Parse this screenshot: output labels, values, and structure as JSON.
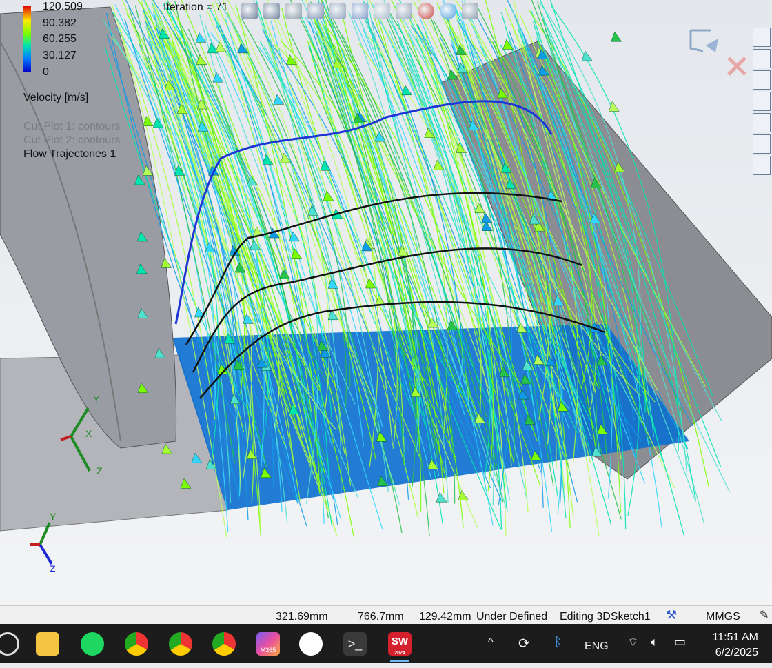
{
  "legend": {
    "ticks": [
      "120.509",
      "90.382",
      "60.255",
      "30.127",
      "0"
    ],
    "title": "Velocity [m/s]",
    "colors": [
      "#e10000",
      "#ffe600",
      "#7cff00",
      "#00e5b0",
      "#0077ff",
      "#0000c8"
    ]
  },
  "plots": [
    {
      "label": "Cut Plot 1: contours",
      "active": false
    },
    {
      "label": "Cut Plot 2: contours",
      "active": false
    },
    {
      "label": "Flow Trajectories 1",
      "active": true
    }
  ],
  "iteration": "Iteration = 71",
  "hud_icons": [
    "zoom-to-fit-icon",
    "zoom-area-icon",
    "previous-view-icon",
    "section-view-icon",
    "dynamic-annotation-icon",
    "view-orientation-icon",
    "display-style-icon",
    "hide-show-icon",
    "edit-appearance-icon",
    "apply-scene-icon",
    "view-settings-icon"
  ],
  "task_pane": [
    "home-icon",
    "3d-parts-icon",
    "file-explorer-icon",
    "view-palette-icon",
    "appearances-icon",
    "custom-properties-icon",
    "solidworks-forum-icon"
  ],
  "status": {
    "x": "321.69mm",
    "y": "766.7mm",
    "z": "129.42mm",
    "state": "Under Defined",
    "editing": "Editing 3DSketch1",
    "units": "MMGS"
  },
  "taskbar": {
    "apps": [
      "start-icon",
      "file-explorer-icon",
      "spotify-icon",
      "chrome-profile-j-icon",
      "chrome-profile-j2-icon",
      "chrome-profile-j3-icon",
      "microsoft-365-icon",
      "slack-icon",
      "terminal-icon",
      "solidworks-2024-icon"
    ],
    "sw_badge_text": "SW",
    "sw_year": "2024",
    "m365_text": "M365",
    "language": "ENG",
    "time": "11:51 AM",
    "date": "6/2/2025"
  }
}
